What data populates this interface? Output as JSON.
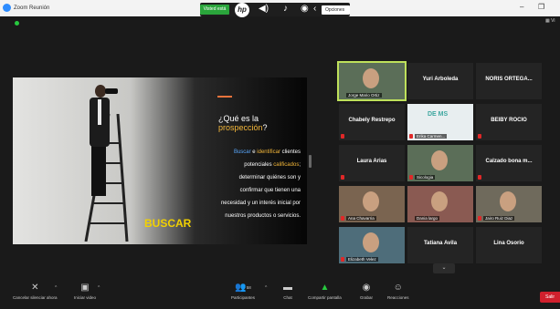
{
  "titlebar": {
    "title": "Zoom Reunión",
    "minimize": "–",
    "maximize": "❐"
  },
  "sharebar": {
    "badge": "Visted está",
    "hp": "hp",
    "options": "Opciones ⌄"
  },
  "view_label": "▦ Vi",
  "slide": {
    "heading1": "¿Qué es la",
    "heading2": "prospección",
    "heading2_q": "?",
    "body": [
      [
        {
          "t": "Buscar",
          "c": "blue"
        },
        {
          "t": " e ",
          "c": "w"
        },
        {
          "t": "identificar",
          "c": "gold"
        },
        {
          "t": " clientes",
          "c": "w"
        }
      ],
      [
        {
          "t": "potenciales",
          "c": "w"
        },
        {
          "t": " calificados",
          "c": "gold"
        },
        {
          "t": ";",
          "c": "w"
        }
      ],
      [
        {
          "t": "determinar quiénes son y",
          "c": "w"
        }
      ],
      [
        {
          "t": "confirmar que tienen una",
          "c": "w"
        }
      ],
      [
        {
          "t": "necesidad y un interés inicial por",
          "c": "w"
        }
      ],
      [
        {
          "t": "nuestros productos o servicios.",
          "c": "w"
        }
      ]
    ],
    "buscar": "BUSCAR"
  },
  "participants": [
    {
      "name": "Jorge Mario Ortiz",
      "video": true,
      "muted": false,
      "speaker": true
    },
    {
      "name": "Yuri Arboleda",
      "video": false,
      "muted": false
    },
    {
      "name": "NORIS ORTEGA...",
      "video": false,
      "muted": false
    },
    {
      "name": "Chabely Restrepo",
      "video": false,
      "muted": true
    },
    {
      "name": "Erika Carmen...",
      "video": true,
      "muted": true,
      "logo": "DE MS"
    },
    {
      "name": "BEIBY ROCIO",
      "video": false,
      "muted": true
    },
    {
      "name": "Laura Arias",
      "video": false,
      "muted": true
    },
    {
      "name": "Sicologia",
      "video": true,
      "muted": true
    },
    {
      "name": "Calzado bona m...",
      "video": false,
      "muted": true
    },
    {
      "name": "Ana Chavarria",
      "video": true,
      "muted": true
    },
    {
      "name": "Dania largo",
      "video": true,
      "muted": false
    },
    {
      "name": "Jairo Ruiz Diaz",
      "video": true,
      "muted": true
    },
    {
      "name": "Elizabeth Velez",
      "video": true,
      "muted": true
    },
    {
      "name": "Tatiana Avila",
      "video": false,
      "muted": false
    },
    {
      "name": "Lina Osorio",
      "video": false,
      "muted": false
    }
  ],
  "toolbar": {
    "mute": "Cancelar silenciar ahora",
    "video": "Iniciar video",
    "participants": "Participantes",
    "participants_count": "58",
    "chat": "Chat",
    "share": "Compartir pantalla",
    "record": "Grabar",
    "reactions": "Reacciones",
    "end": "Salir"
  },
  "colors": {
    "accent_green": "#27c93f",
    "speaker_border": "#bfe15b",
    "end_red": "#d0202d",
    "slide_gold": "#f5b83a",
    "buscar_yellow": "#f2d100"
  }
}
